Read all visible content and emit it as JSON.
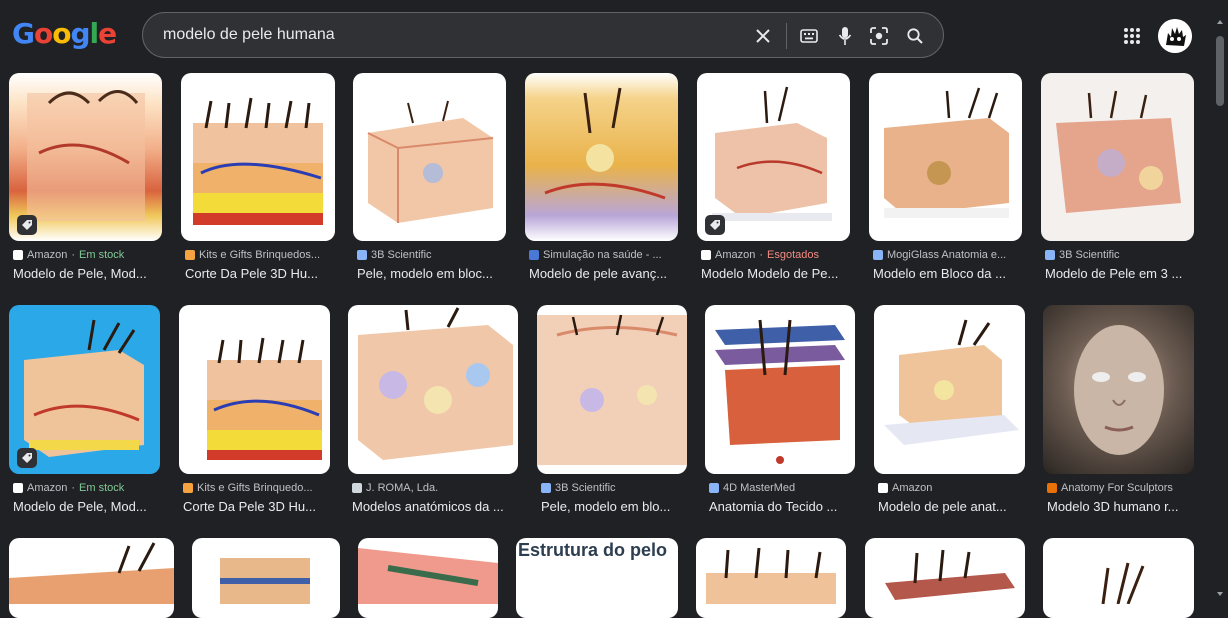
{
  "logo": {
    "letters": [
      "G",
      "o",
      "o",
      "g",
      "l",
      "e"
    ]
  },
  "search": {
    "query": "modelo de pele humana"
  },
  "icons": {
    "clear": "close-icon",
    "keyboard": "keyboard-icon",
    "voice": "mic-icon",
    "lens": "lens-icon",
    "search": "search-icon",
    "apps": "apps-grid-icon"
  },
  "row1": [
    {
      "source": "Amazon",
      "sep": " · ",
      "stock": "Em stock",
      "stock_color": "green",
      "title": "Modelo de Pele, Mod...",
      "favicon_color": "#ffffff"
    },
    {
      "source": "Kits e Gifts Brinquedos...",
      "sep": "",
      "stock": "",
      "stock_color": "",
      "title": "Corte Da Pele 3D Hu...",
      "favicon_color": "#f4a340"
    },
    {
      "source": "3B Scientific",
      "sep": "",
      "stock": "",
      "stock_color": "",
      "title": "Pele, modelo em bloc...",
      "favicon_color": "#8ab4f8"
    },
    {
      "source": "Simulação na saúde - ...",
      "sep": "",
      "stock": "",
      "stock_color": "",
      "title": "Modelo de pele avanç...",
      "favicon_color": "#4a78d6"
    },
    {
      "source": "Amazon",
      "sep": " · ",
      "stock": "Esgotados",
      "stock_color": "red",
      "title": "Modelo Modelo de Pe...",
      "favicon_color": "#ffffff"
    },
    {
      "source": "MogiGlass Anatomia e...",
      "sep": "",
      "stock": "",
      "stock_color": "",
      "title": "Modelo em Bloco da ...",
      "favicon_color": "#8ab4f8"
    },
    {
      "source": "3B Scientific",
      "sep": "",
      "stock": "",
      "stock_color": "",
      "title": "Modelo de Pele em 3 ...",
      "favicon_color": "#8ab4f8"
    }
  ],
  "row2": [
    {
      "source": "Amazon",
      "sep": " · ",
      "stock": "Em stock",
      "stock_color": "green",
      "title": "Modelo de Pele, Mod...",
      "favicon_color": "#ffffff"
    },
    {
      "source": "Kits e Gifts Brinquedo...",
      "sep": "",
      "stock": "",
      "stock_color": "",
      "title": "Corte Da Pele 3D Hu...",
      "favicon_color": "#f4a340"
    },
    {
      "source": "J. ROMA, Lda.",
      "sep": "",
      "stock": "",
      "stock_color": "",
      "title": "Modelos anatómicos da ...",
      "favicon_color": "#cfd8dc"
    },
    {
      "source": "3B Scientific",
      "sep": "",
      "stock": "",
      "stock_color": "",
      "title": "Pele, modelo em blo...",
      "favicon_color": "#8ab4f8"
    },
    {
      "source": "4D MasterMed",
      "sep": "",
      "stock": "",
      "stock_color": "",
      "title": "Anatomia do Tecido ...",
      "favicon_color": "#8ab4f8"
    },
    {
      "source": "Amazon",
      "sep": "",
      "stock": "",
      "stock_color": "",
      "title": "Modelo de pele anat...",
      "favicon_color": "#ffffff"
    },
    {
      "source": "Anatomy For Sculptors",
      "sep": "",
      "stock": "",
      "stock_color": "",
      "title": "Modelo 3D humano r...",
      "favicon_color": "#e8710a"
    }
  ],
  "row3": [
    {
      "caption": ""
    },
    {
      "caption": ""
    },
    {
      "caption": ""
    },
    {
      "caption": "Estrutura do pelo"
    },
    {
      "caption": ""
    },
    {
      "caption": ""
    },
    {
      "caption": ""
    }
  ]
}
